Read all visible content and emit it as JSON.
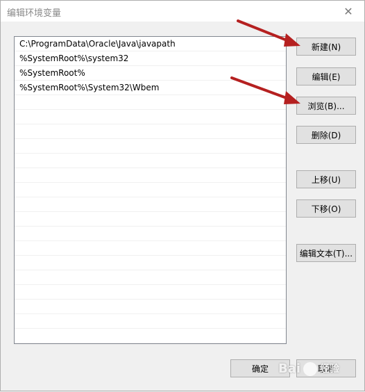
{
  "window": {
    "title": "编辑环境变量",
    "close_glyph": "✕"
  },
  "paths": [
    "C:\\ProgramData\\Oracle\\Java\\javapath",
    "%SystemRoot%\\system32",
    "%SystemRoot%",
    "%SystemRoot%\\System32\\Wbem"
  ],
  "buttons": {
    "new": "新建(N)",
    "edit": "编辑(E)",
    "browse": "浏览(B)...",
    "delete": "删除(D)",
    "move_up": "上移(U)",
    "move_down": "下移(O)",
    "edit_text": "编辑文本(T)...",
    "ok": "确定",
    "cancel": "取消"
  },
  "watermark": {
    "brand": "Bai",
    "suffix": "经验"
  },
  "colors": {
    "arrow": "#b52020"
  }
}
